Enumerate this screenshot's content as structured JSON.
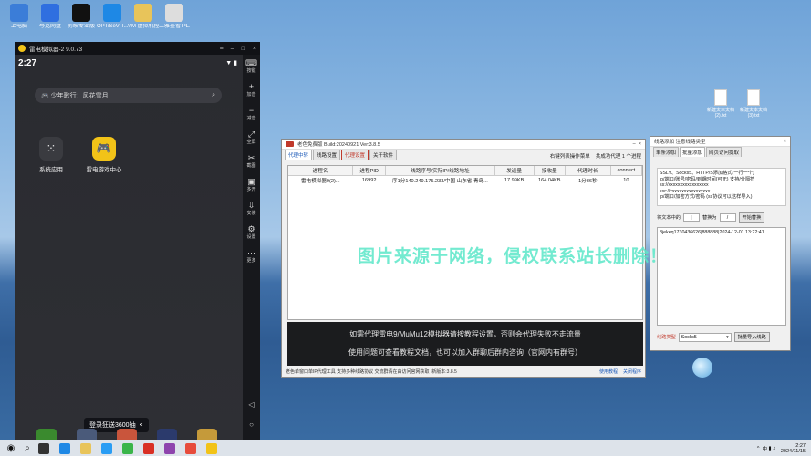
{
  "desktop_icons": [
    {
      "label": "上电脑",
      "color": "#3b7dd8"
    },
    {
      "label": "夸克网盘",
      "color": "#2f6fe0"
    },
    {
      "label": "剪映专业版",
      "color": "#111111"
    },
    {
      "label": "OPTiSeVIT...",
      "color": "#1e88e5"
    },
    {
      "label": "VM 虚拟机控件装依器+日...",
      "color": "#e8c45a"
    },
    {
      "label": "二雅查看 PL.mp4",
      "color": "#dddddd"
    }
  ],
  "emulator": {
    "title": "雷电模拟器-2 9.0.73",
    "time": "2:27",
    "search_text": "少年歌行：风花雪月",
    "apps": [
      {
        "label": "系统应用",
        "color": "#3a3b40"
      },
      {
        "label": "雷电游戏中心",
        "color": "#f2c318"
      }
    ],
    "promo": "登录狂送3600抽",
    "side_buttons": [
      "按键",
      "加音",
      "减音",
      "全屏",
      "截图",
      "多开",
      "安装",
      "设置",
      "更多"
    ],
    "dock_colors": [
      "#3a8a2e",
      "#4a5a7a",
      "#c9553c",
      "#2b3a6c",
      "#c59a3a"
    ]
  },
  "proxy_window": {
    "title": "老色免费版 Build:20240921 Ver:3.8.5",
    "tabs": [
      "代理中转",
      "线路设置",
      "代理设置",
      "关于软件"
    ],
    "note": "右键列表操作菜单",
    "note2": "共成功代理 1 个进程",
    "columns": [
      "进程名",
      "进程PID",
      "线路序号/实际IP/线路地址",
      "发送量",
      "接收量",
      "代理时长",
      "connect"
    ],
    "rows": [
      {
        "name": "雷电模拟器9(2)...",
        "pid": "16992",
        "line": "序1分140.249.175.233/中国 山东省 青岛...",
        "sent": "17.99KB",
        "recv": "164.04KB",
        "duration": "1分36秒",
        "connect": "10"
      }
    ],
    "banner_line1": "如需代理雷电9/MuMu12模拟器请按教程设置，否则会代理失败不走流量",
    "banner_line2": "使用问题可查看教程文档，也可以加入群聊后群内咨询（官网内有群号）",
    "footer": "老色单窗口单IP代理工具 支持多种线路协议 交流群请在由访问官网获取",
    "version": "新版本:3.8.5",
    "link_tutorial": "使用教程",
    "link_close": "关闭程序"
  },
  "add_proxy": {
    "title": "线路添加 注意线路类型",
    "tabs": [
      "单条添加",
      "批量添加",
      "网页访问提取"
    ],
    "desc_lines": [
      "SSLY、Socks5、HTTP/S添加格式(一行一个)",
      "ip/端口/账号/密码/到期时间(可无) 支持/分隔符",
      "ss://xxxxxxxxxxxxxxxxx",
      "ssr://xxxxxxxxxxxxxxxxx",
      "ip/端口/加密方式/密码  (ss协议可以这样导入)"
    ],
    "replace_label": "将文本中的",
    "replace_from": "|",
    "replace_to_label": "替换为",
    "replace_to": "/",
    "replace_button": "开始替换",
    "text_content": "8jekeq1730436626|888888|2024-12-01 13:22:41",
    "type_label": "线路类型",
    "type_value": "Socks5",
    "import_button": "批量导入线路"
  },
  "desktop_files": [
    {
      "label": "新建文本文档 (2).txt"
    },
    {
      "label": "新建文本文档 (3).txt"
    }
  ],
  "watermark": "图片来源于网络，侵权联系站长删除！",
  "taskbar": {
    "icon_colors": [
      "#333333",
      "#1e88e5",
      "#e8c45a",
      "#2a9df4",
      "#3ab54a",
      "#d93025",
      "#8e44ad",
      "#e74c3c",
      "#f2c318"
    ],
    "lang": "中",
    "time": "2:27",
    "date": "2024/11/15"
  }
}
